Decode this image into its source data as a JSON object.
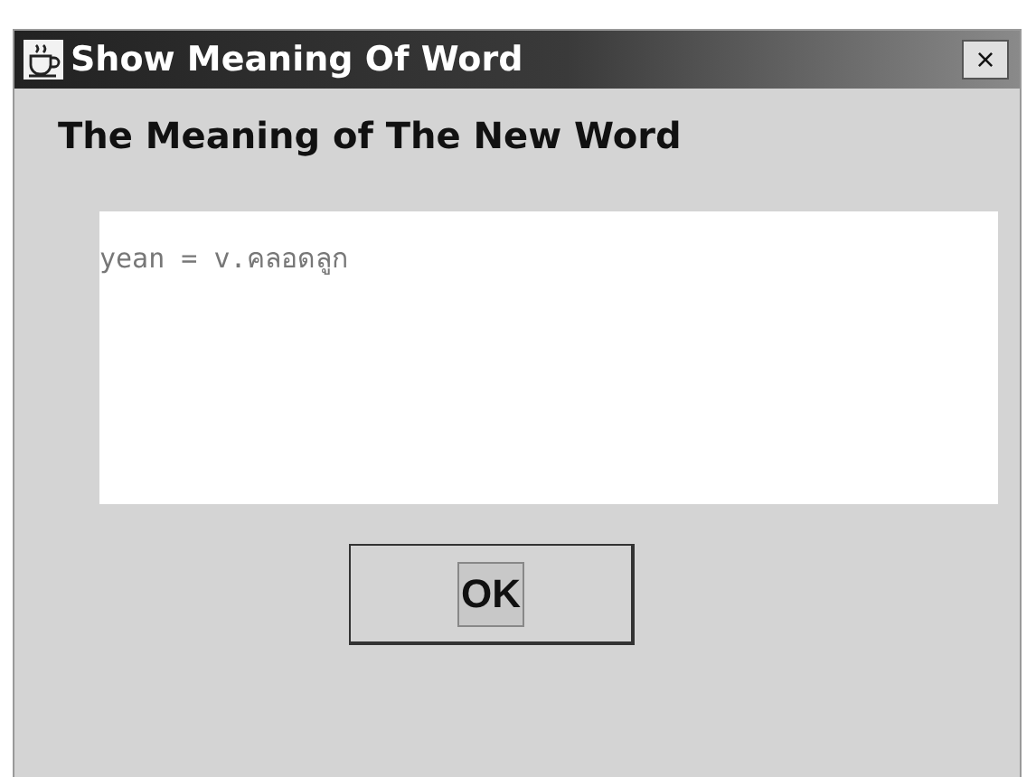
{
  "window": {
    "title": "Show Meaning Of Word",
    "close": "×"
  },
  "heading": "The Meaning of The New Word",
  "meaning": {
    "value": "yean = v.คลอดลูก"
  },
  "buttons": [
    {
      "label": "OK",
      "focused": true
    }
  ]
}
